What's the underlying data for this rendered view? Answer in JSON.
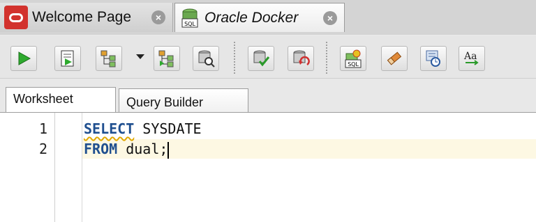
{
  "doc_tabs": [
    {
      "label": "Welcome Page",
      "close": "×"
    },
    {
      "label": "Oracle Docker",
      "close": "×"
    }
  ],
  "toolbar": {
    "icons": [
      "run-statement-icon",
      "run-script-icon",
      "database-tree-icon",
      "dropdown-arrow-icon",
      "explain-plan-icon",
      "autotrace-icon",
      "commit-icon",
      "rollback-icon",
      "sql-tuning-icon",
      "clear-icon",
      "history-icon",
      "change-case-icon"
    ]
  },
  "worksheet_tabs": [
    {
      "label": "Worksheet"
    },
    {
      "label": "Query Builder"
    }
  ],
  "editor": {
    "lines": [
      {
        "num": "1",
        "keyword": "SELECT",
        "rest": " SYSDATE"
      },
      {
        "num": "2",
        "keyword": "FROM",
        "rest": " dual;"
      }
    ]
  },
  "colors": {
    "keyword": "#1f4f8f",
    "current_line": "#fdf8e3",
    "oracle_red": "#d2322d"
  }
}
